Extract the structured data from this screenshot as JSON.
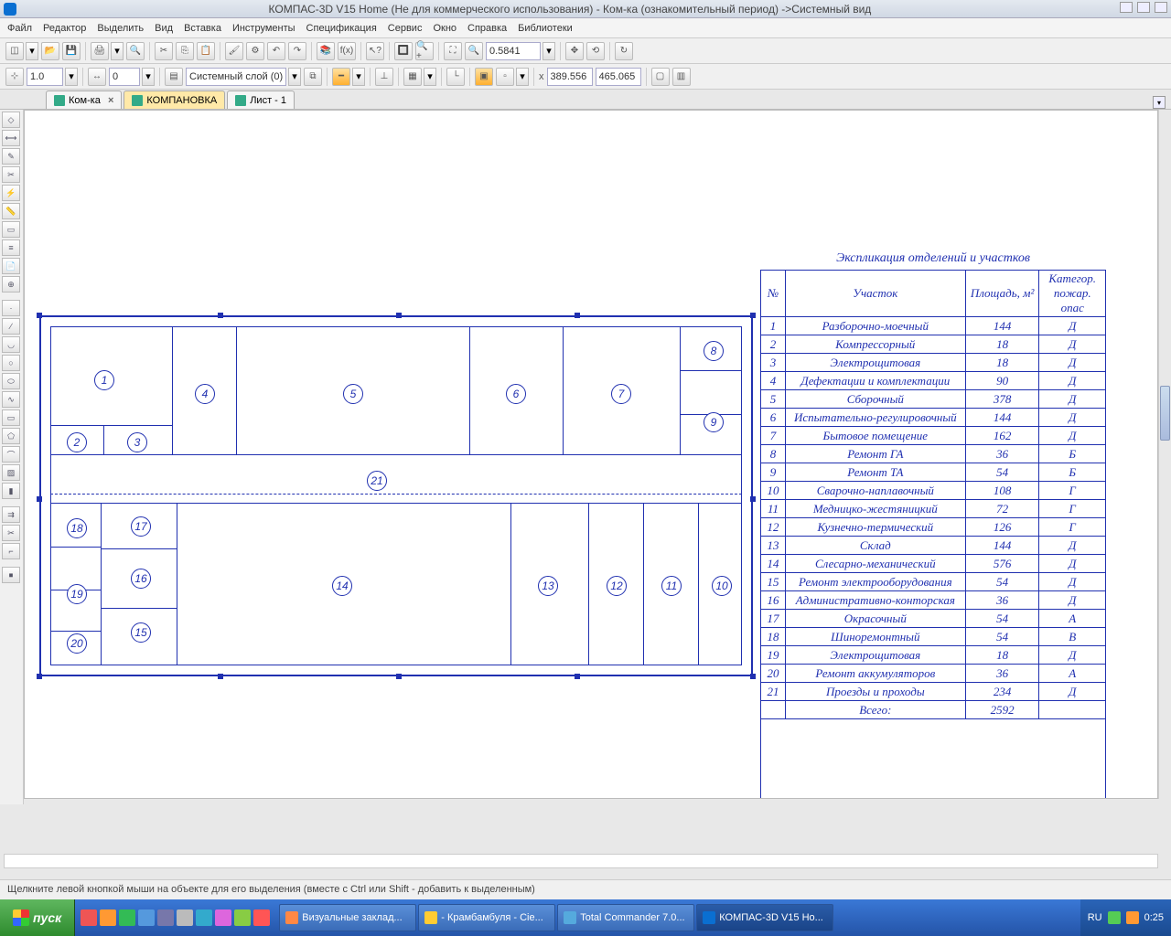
{
  "title": "КОМПАС-3D V15 Home (Не для коммерческого использования) - Ком-ка (ознакомительный период) ->Системный вид",
  "menu": [
    "Файл",
    "Редактор",
    "Выделить",
    "Вид",
    "Вставка",
    "Инструменты",
    "Спецификация",
    "Сервис",
    "Окно",
    "Справка",
    "Библиотеки"
  ],
  "toolbar2_scale": "1.0",
  "toolbar2_val": "0",
  "toolbar2_layer": "Системный слой (0)",
  "toolbar1_zoom": "0.5841",
  "coord_x": "389.556",
  "coord_y": "465.065",
  "tabs": [
    {
      "label": "Ком-ка",
      "active": false,
      "closable": true
    },
    {
      "label": "КОМПАНОВКА",
      "active": true,
      "closable": false
    },
    {
      "label": "Лист - 1",
      "active": false,
      "closable": false
    }
  ],
  "plan_rooms": [
    "1",
    "2",
    "3",
    "4",
    "5",
    "6",
    "7",
    "8",
    "9",
    "10",
    "11",
    "12",
    "13",
    "14",
    "15",
    "16",
    "17",
    "18",
    "19",
    "20",
    "21"
  ],
  "explication": {
    "title": "Экспликация отделений и участков",
    "headers": [
      "№",
      "Участок",
      "Площадь, м²",
      "Категор. пожар. опас"
    ],
    "rows": [
      [
        "1",
        "Разборочно-моечный",
        "144",
        "Д"
      ],
      [
        "2",
        "Компрессорный",
        "18",
        "Д"
      ],
      [
        "3",
        "Электрощитовая",
        "18",
        "Д"
      ],
      [
        "4",
        "Дефектации и комплектации",
        "90",
        "Д"
      ],
      [
        "5",
        "Сборочный",
        "378",
        "Д"
      ],
      [
        "6",
        "Испытательно-регулировочный",
        "144",
        "Д"
      ],
      [
        "7",
        "Бытовое помещение",
        "162",
        "Д"
      ],
      [
        "8",
        "Ремонт ГА",
        "36",
        "Б"
      ],
      [
        "9",
        "Ремонт ТА",
        "54",
        "Б"
      ],
      [
        "10",
        "Сварочно-наплавочный",
        "108",
        "Г"
      ],
      [
        "11",
        "Медницко-жестяницкий",
        "72",
        "Г"
      ],
      [
        "12",
        "Кузнечно-термический",
        "126",
        "Г"
      ],
      [
        "13",
        "Склад",
        "144",
        "Д"
      ],
      [
        "14",
        "Слесарно-механический",
        "576",
        "Д"
      ],
      [
        "15",
        "Ремонт электрооборудования",
        "54",
        "Д"
      ],
      [
        "16",
        "Административно-конторская",
        "36",
        "Д"
      ],
      [
        "17",
        "Окрасочный",
        "54",
        "А"
      ],
      [
        "18",
        "Шиноремонтный",
        "54",
        "В"
      ],
      [
        "19",
        "Электрощитовая",
        "18",
        "Д"
      ],
      [
        "20",
        "Ремонт аккумуляторов",
        "36",
        "А"
      ],
      [
        "21",
        "Проезды и проходы",
        "234",
        "Д"
      ]
    ],
    "total_label": "Всего:",
    "total_value": "2592"
  },
  "hint": "Щелкните левой кнопкой мыши на объекте для его выделения (вместе с Ctrl или Shift - добавить к выделенным)",
  "start_label": "пуск",
  "taskbar_tasks": [
    "Визуальные заклад...",
    "- Крамбамбуля - Cie...",
    "Total Commander 7.0...",
    "КОМПАС-3D V15 Ho..."
  ],
  "tray_lang": "RU",
  "tray_time": "0:25"
}
